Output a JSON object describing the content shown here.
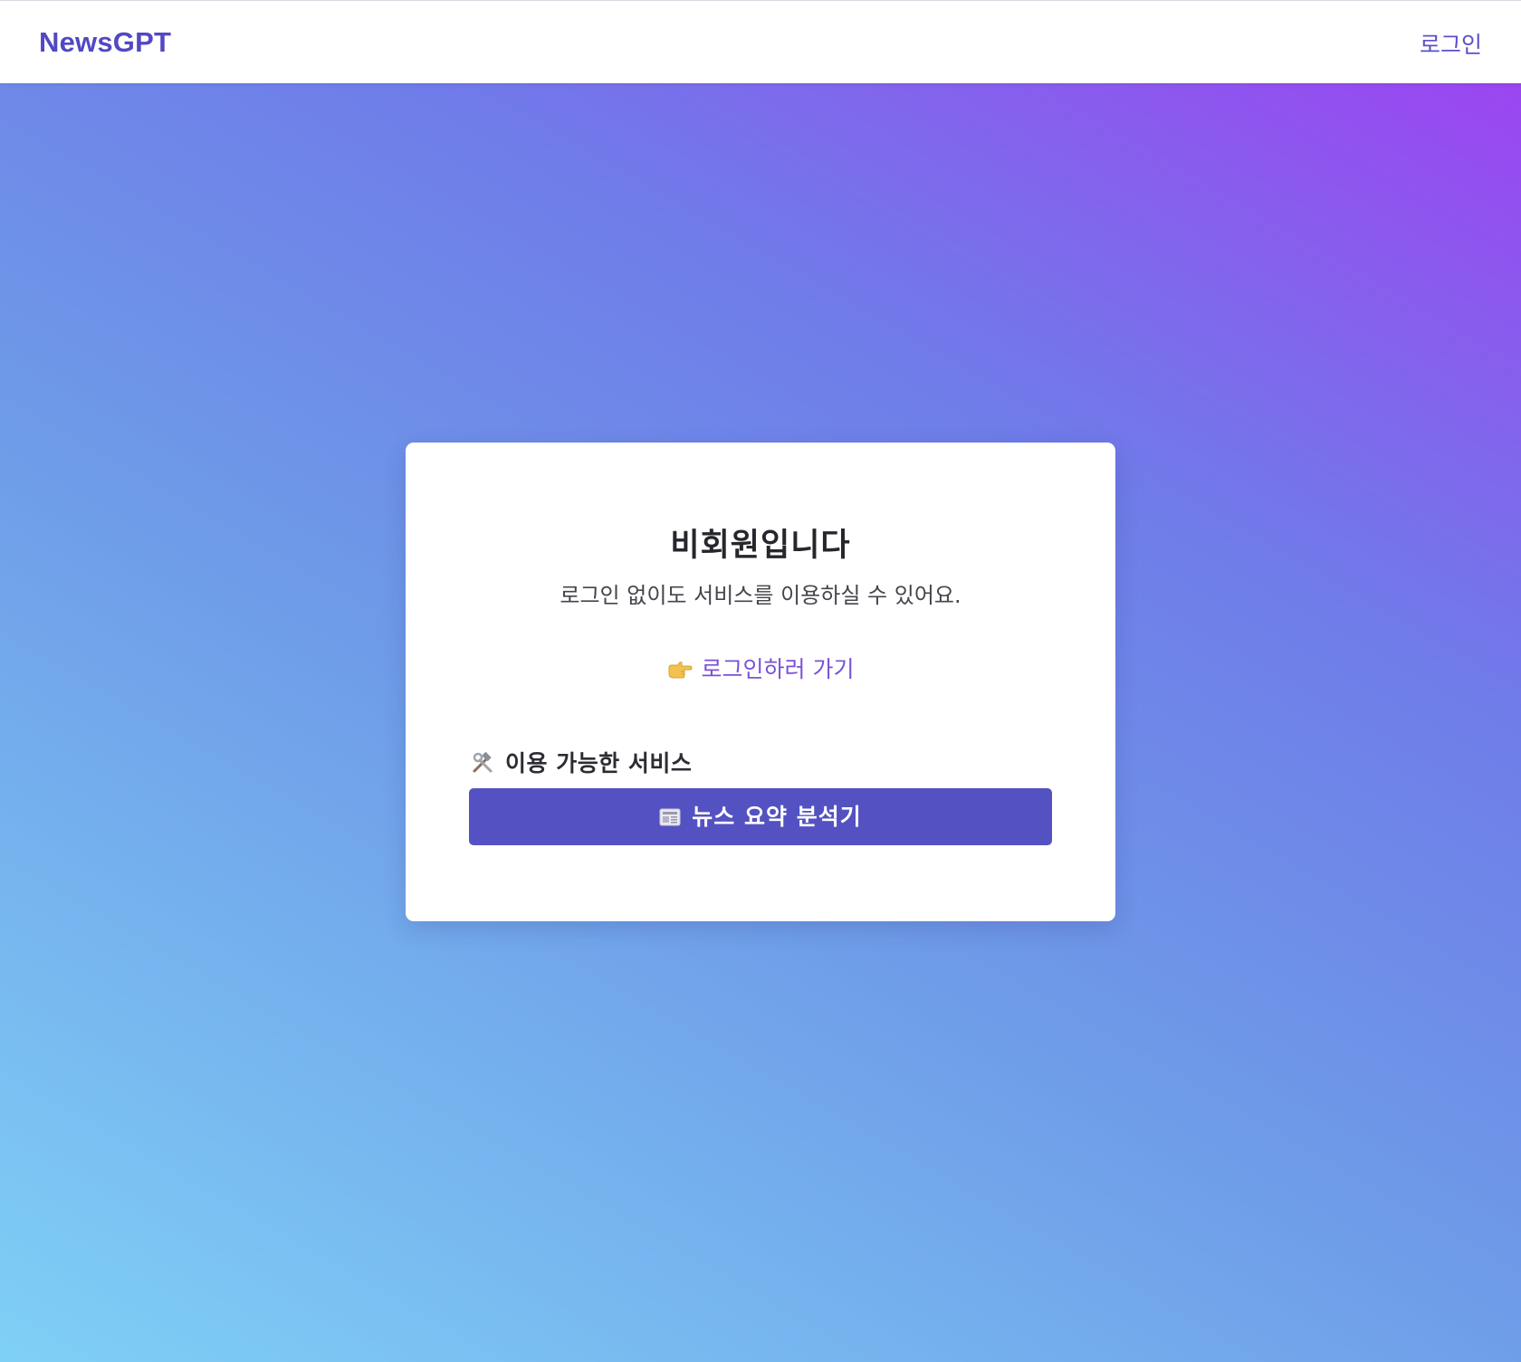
{
  "navbar": {
    "brand": "NewsGPT",
    "login_label": "로그인"
  },
  "card": {
    "title": "비회원입니다",
    "subtitle": "로그인 없이도 서비스를 이용하실 수 있어요.",
    "login_link": {
      "icon": "pointing-hand-icon",
      "label": "로그인하러 가기"
    },
    "services": {
      "icon": "hammer-wrench-icon",
      "heading": "이용 가능한 서비스",
      "items": [
        {
          "icon": "newspaper-icon",
          "label": "뉴스 요약 분석기"
        }
      ]
    }
  },
  "colors": {
    "brand": "#5248c2",
    "button": "#5452c2",
    "link": "#7a52d6",
    "gradient_start": "#7fd0f6",
    "gradient_end": "#a13ef2"
  }
}
